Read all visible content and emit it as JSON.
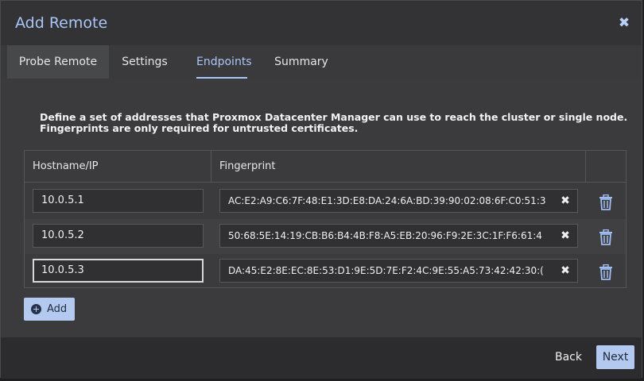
{
  "dialog": {
    "title": "Add Remote",
    "close_icon": "close-icon"
  },
  "tabs": [
    {
      "label": "Probe Remote"
    },
    {
      "label": "Settings"
    },
    {
      "label": "Endpoints",
      "selected": true
    },
    {
      "label": "Summary"
    }
  ],
  "endpoints": {
    "description": "Define a set of addresses that Proxmox Datacenter Manager can use to reach the cluster or single node. Fingerprints are only required for untrusted certificates.",
    "columns": {
      "hostname": "Hostname/IP",
      "fingerprint": "Fingerprint"
    },
    "rows": [
      {
        "hostname": "10.0.5.1",
        "fingerprint": "AC:E2:A9:C6:7F:48:E1:3D:E8:DA:24:6A:BD:39:90:02:08:6F:C0:51:3"
      },
      {
        "hostname": "10.0.5.2",
        "fingerprint": "50:68:5E:14:19:CB:B6:B4:4B:F8:A5:EB:20:96:F9:2E:3C:1F:F6:61:4"
      },
      {
        "hostname": "10.0.5.3",
        "fingerprint": "DA:45:E2:8E:EC:8E:53:D1:9E:5D:7E:F2:4C:9E:55:A5:73:42:42:30:("
      }
    ],
    "add_label": "Add"
  },
  "footer": {
    "back_label": "Back",
    "next_label": "Next"
  },
  "colors": {
    "accent": "#a9c6f6",
    "button_bg": "#b4c9ef"
  }
}
